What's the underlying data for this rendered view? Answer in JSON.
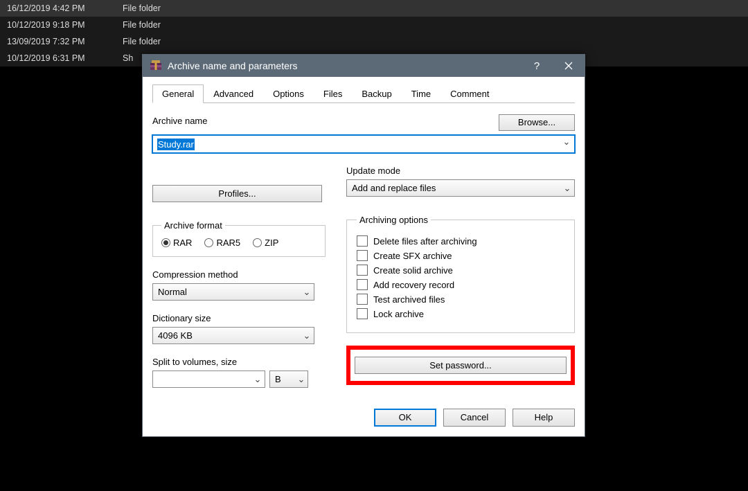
{
  "bg_rows": [
    {
      "date": "16/12/2019 4:42 PM",
      "type": "File folder",
      "hilite": true
    },
    {
      "date": "10/12/2019 9:18 PM",
      "type": "File folder",
      "hilite": false
    },
    {
      "date": "13/09/2019 7:32 PM",
      "type": "File folder",
      "hilite": false
    },
    {
      "date": "10/12/2019 6:31 PM",
      "type": "Sh",
      "hilite": false
    }
  ],
  "title": "Archive name and parameters",
  "tabs": [
    "General",
    "Advanced",
    "Options",
    "Files",
    "Backup",
    "Time",
    "Comment"
  ],
  "active_tab": 0,
  "labels": {
    "archive_name": "Archive name",
    "browse": "Browse...",
    "profiles": "Profiles...",
    "update_mode": "Update mode",
    "archive_format": "Archive format",
    "compression_method": "Compression method",
    "dictionary_size": "Dictionary size",
    "split_volumes": "Split to volumes, size",
    "archiving_options": "Archiving options",
    "set_password": "Set password...",
    "ok": "OK",
    "cancel": "Cancel",
    "help": "Help"
  },
  "archive_name_value": "Study.rar",
  "update_mode_value": "Add and replace files",
  "formats": [
    "RAR",
    "RAR5",
    "ZIP"
  ],
  "format_selected": 0,
  "compression_method_value": "Normal",
  "dictionary_size_value": "4096 KB",
  "split_value": "",
  "split_unit": "B",
  "archiving_options": [
    "Delete files after archiving",
    "Create SFX archive",
    "Create solid archive",
    "Add recovery record",
    "Test archived files",
    "Lock archive"
  ]
}
